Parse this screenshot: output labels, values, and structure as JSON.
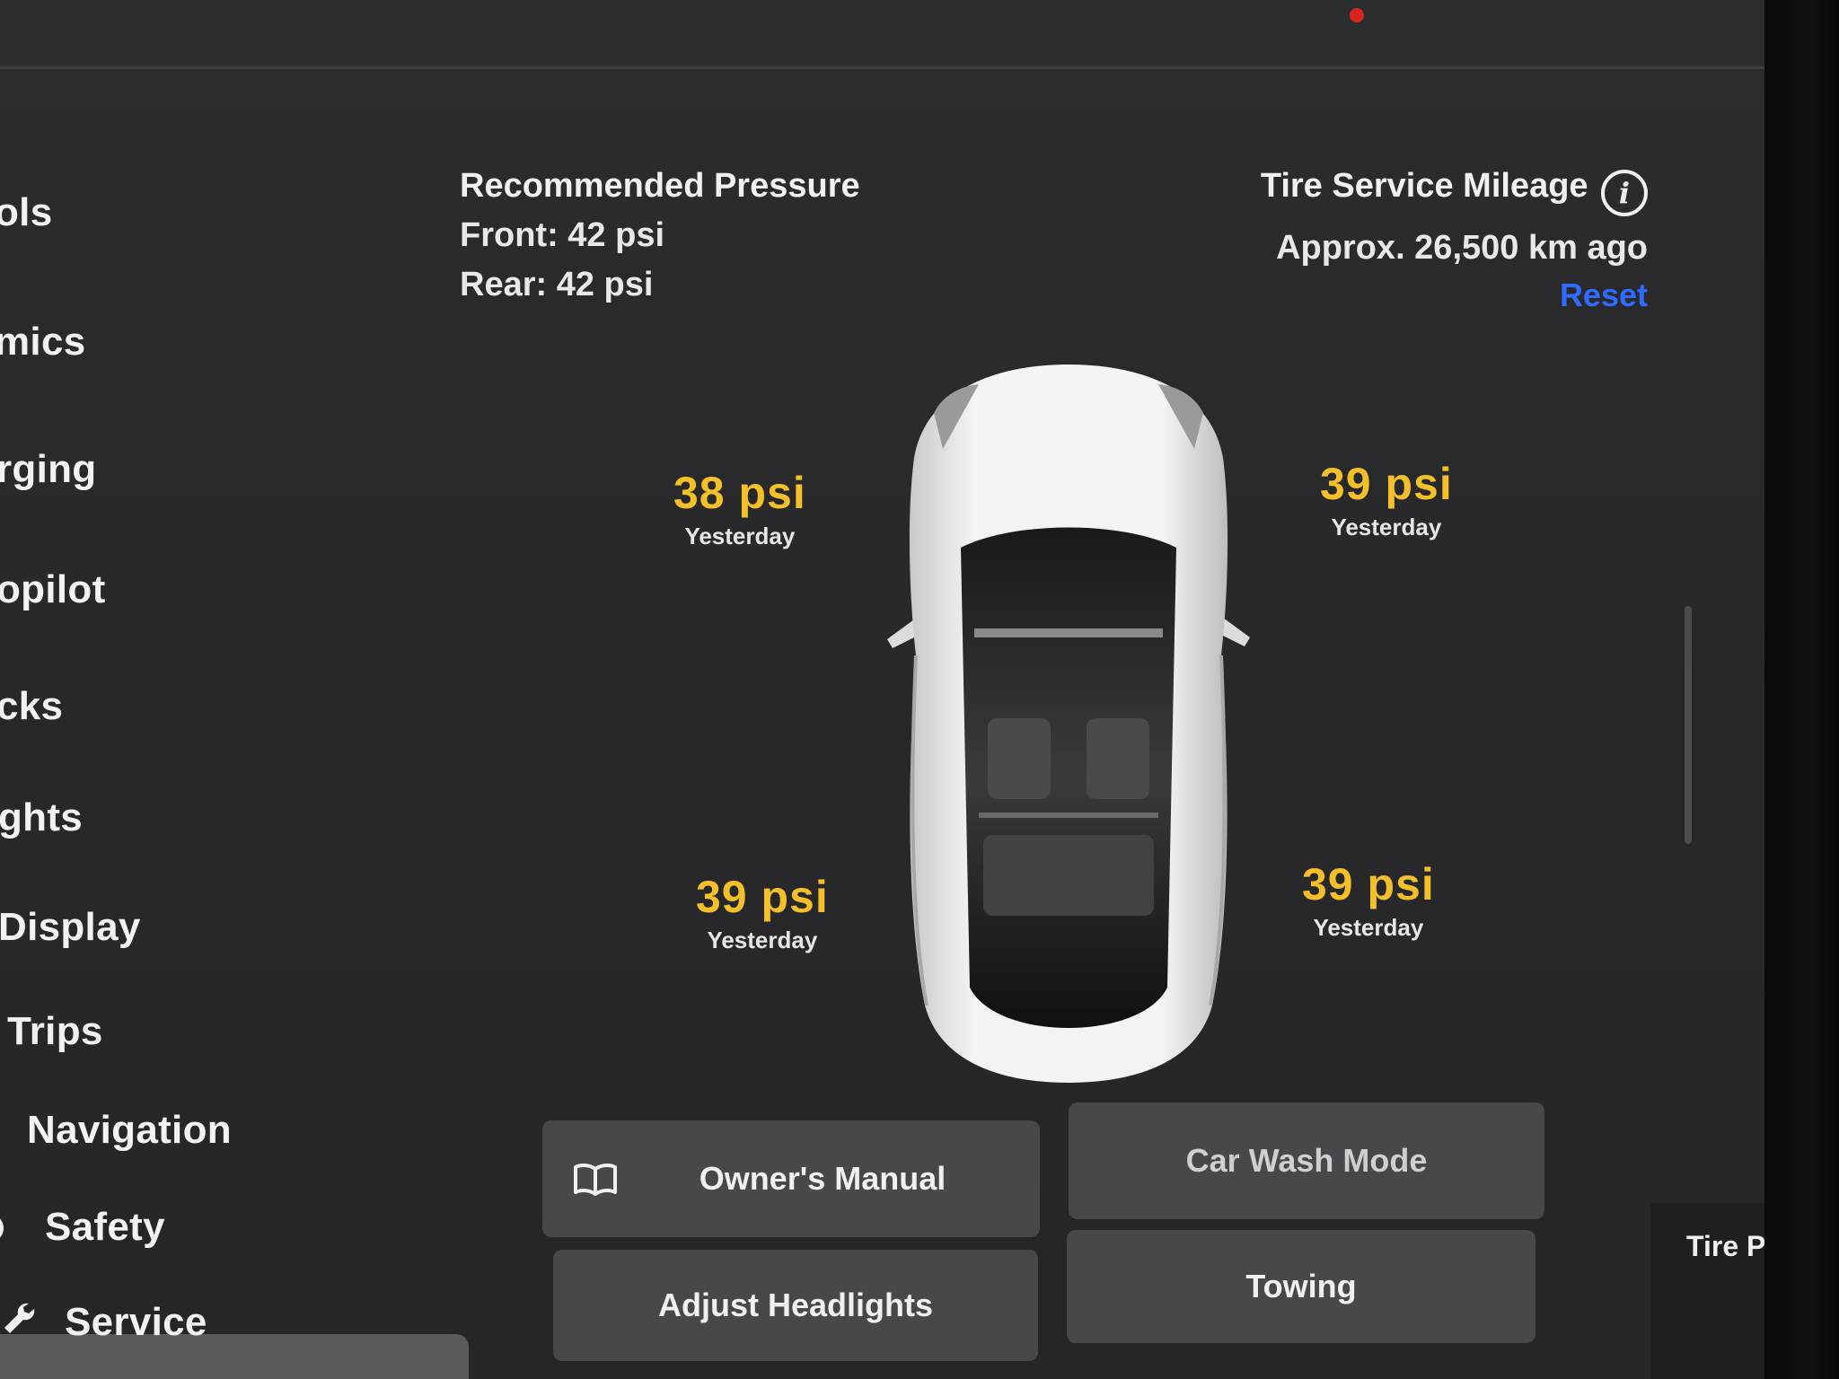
{
  "sidebar": {
    "items": [
      {
        "label": "Controls",
        "visible_text": "ols"
      },
      {
        "label": "Dynamics",
        "visible_text": "mics"
      },
      {
        "label": "Charging",
        "visible_text": "rging"
      },
      {
        "label": "Autopilot",
        "visible_text": "opilot"
      },
      {
        "label": "Locks",
        "visible_text": "cks"
      },
      {
        "label": "Lights",
        "visible_text": "ghts"
      },
      {
        "label": "Display",
        "visible_text": "Display"
      },
      {
        "label": "Trips",
        "visible_text": "Trips"
      },
      {
        "label": "Navigation",
        "visible_text": "Navigation"
      },
      {
        "label": "Safety",
        "visible_text": "Safety"
      },
      {
        "label": "Service",
        "visible_text": "Service",
        "selected": true
      }
    ]
  },
  "recommended_pressure": {
    "title": "Recommended Pressure",
    "front": "Front: 42 psi",
    "rear": "Rear: 42 psi"
  },
  "tire_service": {
    "title": "Tire Service Mileage",
    "mileage": "Approx. 26,500 km ago",
    "reset_label": "Reset"
  },
  "tires": {
    "front_left": {
      "psi": "38 psi",
      "when": "Yesterday"
    },
    "front_right": {
      "psi": "39 psi",
      "when": "Yesterday"
    },
    "rear_left": {
      "psi": "39 psi",
      "when": "Yesterday"
    },
    "rear_right": {
      "psi": "39 psi",
      "when": "Yesterday"
    }
  },
  "buttons": {
    "owners_manual": "Owner's Manual",
    "car_wash_mode": "Car Wash Mode",
    "adjust_headlights": "Adjust Headlights",
    "towing": "Towing"
  },
  "right_panel": {
    "label": "Tire Pressu"
  },
  "colors": {
    "psi_value": "#f4c02a",
    "link": "#2f6bff",
    "background": "#2a2a2c",
    "button": "#47484b",
    "selected_nav": "#5a5b5e"
  }
}
